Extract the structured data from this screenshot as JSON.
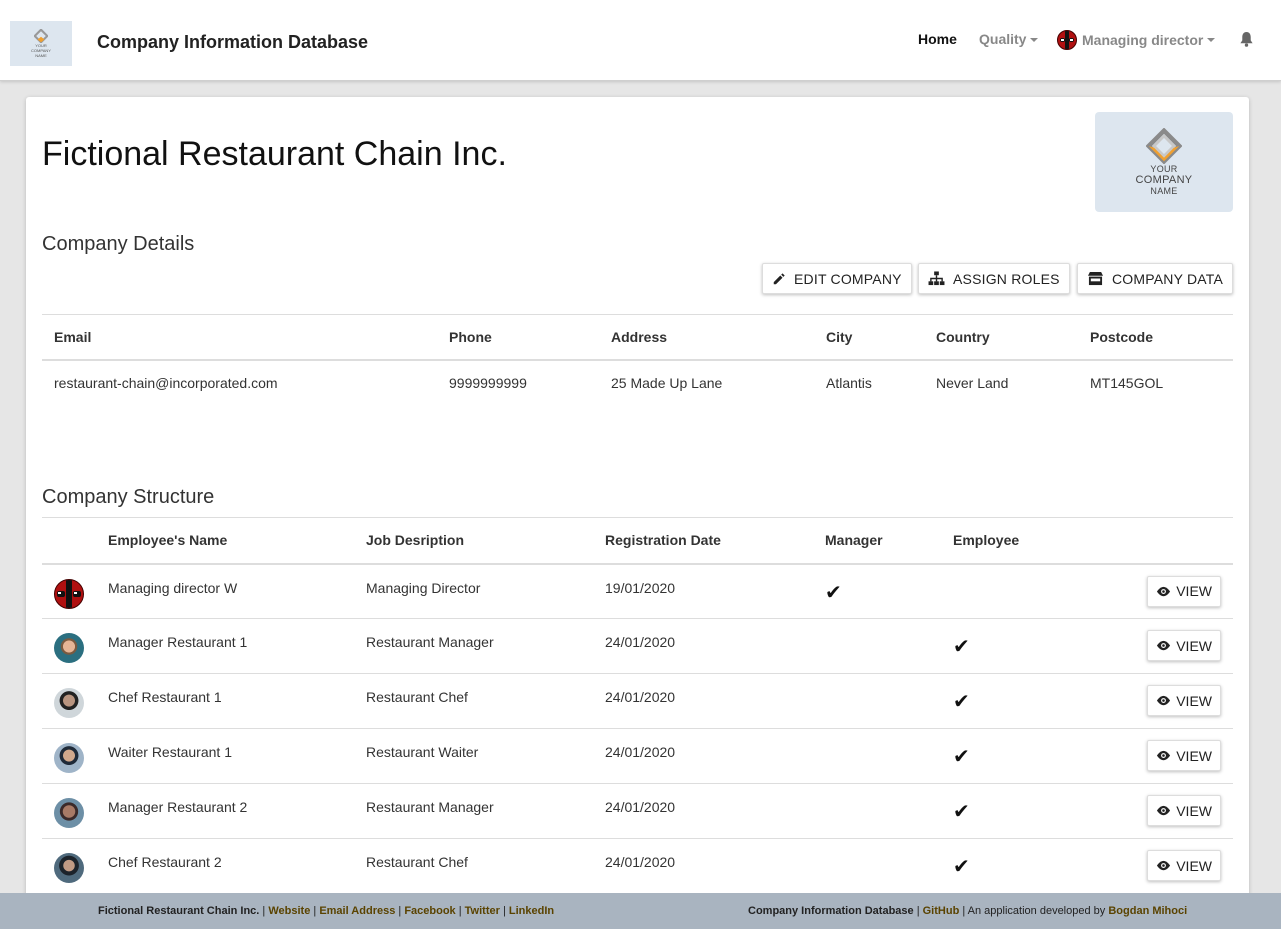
{
  "navbar": {
    "brand": "Company Information Database",
    "logo_lines": [
      "YOUR",
      "COMPANY",
      "NAME"
    ],
    "home": "Home",
    "quality": "Quality",
    "user": "Managing director"
  },
  "company": {
    "name": "Fictional Restaurant Chain Inc.",
    "logo_lines": [
      "YOUR",
      "COMPANY",
      "NAME"
    ]
  },
  "details": {
    "title": "Company Details",
    "buttons": {
      "edit": "EDIT COMPANY",
      "assign": "ASSIGN ROLES",
      "data": "COMPANY DATA"
    },
    "headers": [
      "Email",
      "Phone",
      "Address",
      "City",
      "Country",
      "Postcode"
    ],
    "row": [
      "restaurant-chain@incorporated.com",
      "9999999999",
      "25 Made Up Lane",
      "Atlantis",
      "Never Land",
      "MT145GOL"
    ]
  },
  "structure": {
    "title": "Company Structure",
    "headers": [
      "",
      "Employee's Name",
      "Job Desription",
      "Registration Date",
      "Manager",
      "Employee",
      ""
    ],
    "view_label": "VIEW",
    "rows": [
      {
        "name": "Managing director W",
        "job": "Managing Director",
        "date": "19/01/2020",
        "manager": true,
        "employee": false
      },
      {
        "name": "Manager Restaurant 1",
        "job": "Restaurant Manager",
        "date": "24/01/2020",
        "manager": false,
        "employee": true
      },
      {
        "name": "Chef Restaurant 1",
        "job": "Restaurant Chef",
        "date": "24/01/2020",
        "manager": false,
        "employee": true
      },
      {
        "name": "Waiter Restaurant 1",
        "job": "Restaurant Waiter",
        "date": "24/01/2020",
        "manager": false,
        "employee": true
      },
      {
        "name": "Manager Restaurant 2",
        "job": "Restaurant Manager",
        "date": "24/01/2020",
        "manager": false,
        "employee": true
      },
      {
        "name": "Chef Restaurant 2",
        "job": "Restaurant Chef",
        "date": "24/01/2020",
        "manager": false,
        "employee": true
      }
    ],
    "check_glyph": "✔"
  },
  "footer": {
    "company": "Fictional Restaurant Chain Inc.",
    "links_left": [
      "Website",
      "Email Address",
      "Facebook",
      "Twitter",
      "LinkedIn"
    ],
    "app_name": "Company Information Database",
    "github": "GitHub",
    "developed_by": "An application developed by",
    "author": "Bogdan Mihoci"
  }
}
